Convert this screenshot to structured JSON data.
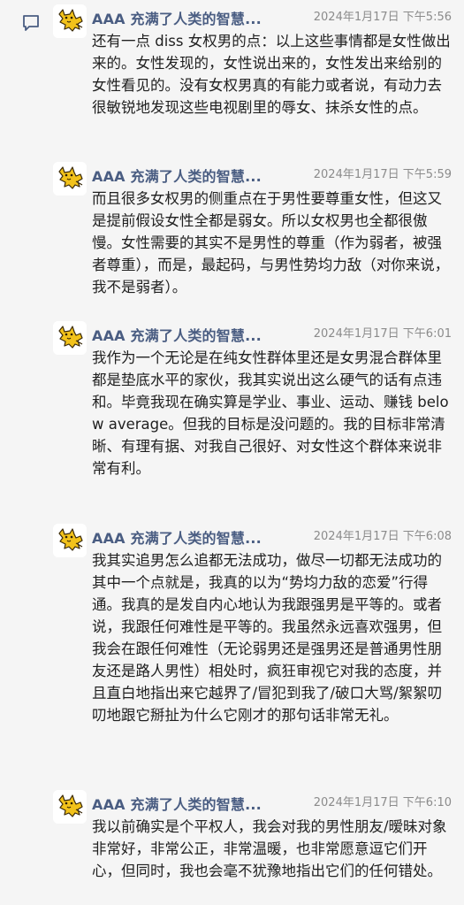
{
  "messages": [
    {
      "sender": "AAA 充满了人类的智慧...",
      "time": "2024年1月17日 下午5:56",
      "text": "还有一点 diss 女权男的点：以上这些事情都是女性做出来的。女性发现的，女性说出来的，女性发出来给别的女性看见的。没有女权男真的有能力或者说，有动力去很敏锐地发现这些电视剧里的辱女、抹杀女性的点。"
    },
    {
      "sender": "AAA 充满了人类的智慧...",
      "time": "2024年1月17日 下午5:59",
      "text": "而且很多女权男的侧重点在于男性要尊重女性，但这又是提前假设女性全都是弱女。所以女权男也全都很傲慢。女性需要的其实不是男性的尊重（作为弱者，被强者尊重），而是，最起码，与男性势均力敌（对你来说，我不是弱者）。"
    },
    {
      "sender": "AAA 充满了人类的智慧...",
      "time": "2024年1月17日 下午6:01",
      "text": "我作为一个无论是在纯女性群体里还是女男混合群体里都是垫底水平的家伙，我其实说出这么硬气的话有点违和。毕竟我现在确实算是学业、事业、运动、赚钱 below average。但我的目标是没问题的。我的目标非常清晰、有理有据、对我自己很好、对女性这个群体来说非常有利。"
    },
    {
      "sender": "AAA 充满了人类的智慧...",
      "time": "2024年1月17日 下午6:08",
      "text": "我其实追男怎么追都无法成功，做尽一切都无法成功的其中一个点就是，我真的以为“势均力敌的恋爱”行得通。我真的是发自内心地认为我跟强男是平等的。或者说，我跟任何难性是平等的。我虽然永远喜欢强男，但我会在跟任何难性（无论弱男还是强男还是普通男性朋友还是路人男性）相处时，疯狂审视它对我的态度，并且直白地指出来它越界了/冒犯到我了/破口大骂/絮絮叨叨地跟它掰扯为什么它刚才的那句话非常无礼。"
    },
    {
      "sender": "AAA 充满了人类的智慧...",
      "time": "2024年1月17日 下午6:10",
      "text": "我以前确实是个平权人，我会对我的男性朋友/暧昧对象非常好，非常公正，非常温暖，也非常愿意逗它们开心，但同时，我也会毫不犹豫地指出它们的任何错处。"
    }
  ]
}
